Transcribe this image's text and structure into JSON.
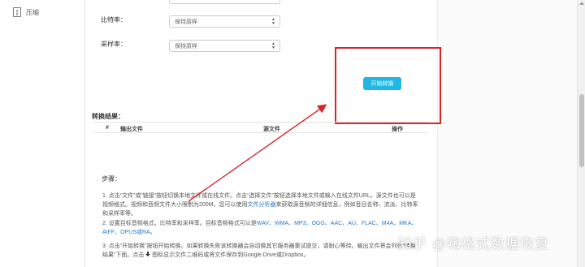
{
  "sidebar": {
    "items": [
      {
        "label": "压缩",
        "icon": "archive-icon"
      }
    ]
  },
  "settings": {
    "bitrate": {
      "label": "比特率：",
      "value": "保持原样"
    },
    "samplerate": {
      "label": "采样率：",
      "value": "保持原样"
    }
  },
  "convert": {
    "start_label": "开始转换",
    "accent_color": "#1fb7e3"
  },
  "results": {
    "title": "转换结果：",
    "columns": [
      "#",
      "输出文件",
      "源文件",
      "操作"
    ]
  },
  "steps": {
    "title": "步骤：",
    "step1": "1. 点击“文件”或“链接”按钮切换本地文件或在线文件。点击“选择文件”按钮选择本地文件或输入在线文件URL。源文件也可以是视频格式。视频和音频文件大小限制为200M。您可以使用",
    "step1_link": "文件分析器",
    "step1_tail": "来获取源音频的详细信息，例如音目名称、流派、比特率和采样率等。",
    "step2": "2. 设置目标音频格式、比特率和采样率。目标音频格式可以是",
    "step2_formats": "WAV、WMA、MP3、OGG、AAC、AU、FLAC、M4A、MKA、AIFF、OPUS或RA",
    "step2_tail": "。",
    "step3": "3. 点击“开始转换”按钮开始转换。如果转换失败该转换器会自动换其它服务器重试提交，请耐心等待。输出文件将会列在“转换结果”下面。点击",
    "step3_tail": "图标显示文件二维码或将文件保存到Google Drive或Dropbox。"
  },
  "watermark": "知乎 @嗨格式数据恢复",
  "annotation": {
    "highlight_color": "#d8252a"
  }
}
